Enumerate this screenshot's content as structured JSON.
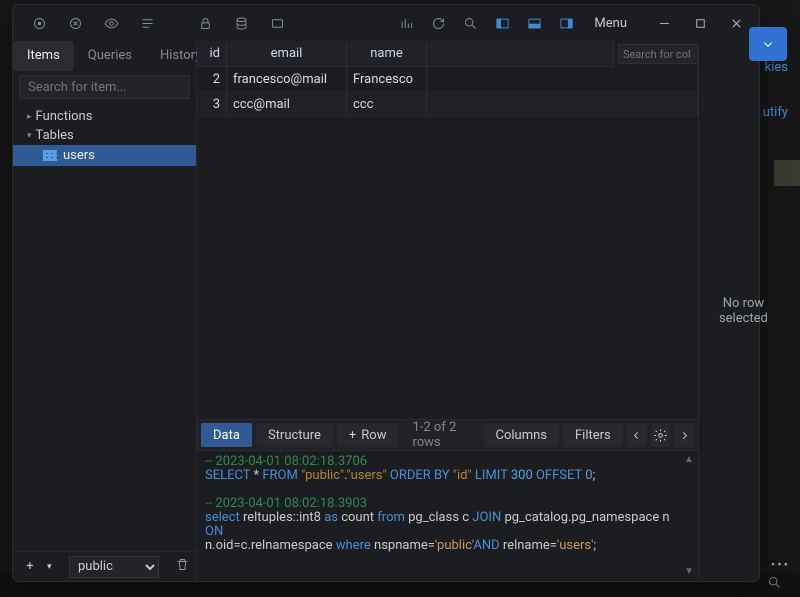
{
  "underlay": {
    "link1": "kies",
    "link2": "utify"
  },
  "titlebar": {
    "menu": "Menu"
  },
  "expand_caret": "⌄",
  "sidebar": {
    "tabs": {
      "items": "Items",
      "queries": "Queries",
      "history": "History"
    },
    "search_ph": "Search for item...",
    "nodes": {
      "functions": "Functions",
      "tables": "Tables"
    },
    "leaf": "users",
    "schema": "public"
  },
  "grid": {
    "cols": {
      "id": "id",
      "email": "email",
      "name": "name"
    },
    "colsearch_ph": "Search for col",
    "rows": [
      {
        "id": "2",
        "email": "francesco@mail",
        "name": "Francesco"
      },
      {
        "id": "3",
        "email": "ccc@mail",
        "name": "ccc"
      }
    ]
  },
  "tabs": {
    "data": "Data",
    "structure": "Structure",
    "row": "Row",
    "status": "1-2 of 2 rows",
    "columns": "Columns",
    "filters": "Filters"
  },
  "inspector": {
    "line1": "No row",
    "line2": "selected"
  },
  "console": {
    "l1": "-- 2023-04-01 08:02:18.3706",
    "l2a": "SELECT ",
    "l2b": "* ",
    "l2c": "FROM ",
    "l2d": "\"public\"",
    "l2e": ".",
    "l2f": "\"users\"",
    "l2g": " ORDER BY ",
    "l2h": "\"id\"",
    "l2i": " LIMIT ",
    "l2j": "300",
    "l2k": " OFFSET ",
    "l2l": "0",
    "l2m": ";",
    "l3": "-- 2023-04-01 08:02:18.3903",
    "l4a": "select ",
    "l4b": "reltuples::int8 ",
    "l4c": "as",
    "l4d": " count ",
    "l4e": "from ",
    "l4f": "pg_class c ",
    "l4g": "JOIN ",
    "l4h": "pg_catalog.pg_namespace n ",
    "l4i": "ON",
    "l5a": "n.oid=c.relnamespace ",
    "l5b": "where ",
    "l5c": "nspname=",
    "l5d": "'public'",
    "l5e": "AND ",
    "l5f": "relname=",
    "l5g": "'users'",
    "l5h": ";"
  }
}
